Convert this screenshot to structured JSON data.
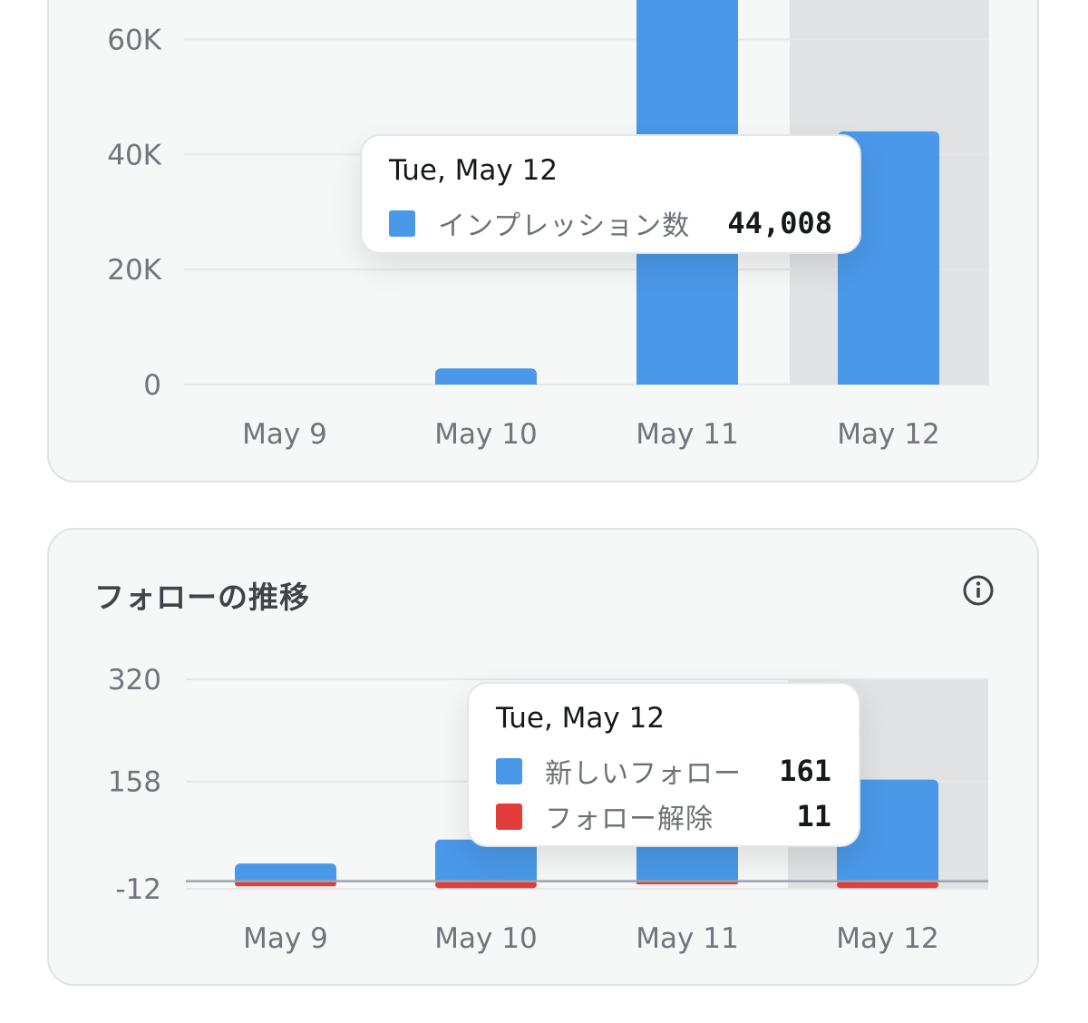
{
  "colors": {
    "blue": "#4a98e8",
    "red": "#e23d3a",
    "grid": "#e3e7ea",
    "axis_text": "#6f757b",
    "highlight": "#e1e2e3"
  },
  "impressions_card": {
    "tooltip": {
      "title": "Tue, May 12",
      "label": "インプレッション数",
      "value": "44,008"
    }
  },
  "follows_card": {
    "title": "フォローの推移",
    "info_icon": "info-icon",
    "tooltip": {
      "title": "Tue, May 12",
      "rows": [
        {
          "label": "新しいフォロー",
          "value": "161"
        },
        {
          "label": "フォロー解除",
          "value": "11"
        }
      ]
    }
  },
  "chart_data": [
    {
      "type": "bar",
      "categories": [
        "May 9",
        "May 10",
        "May 11",
        "May 12"
      ],
      "series": [
        {
          "name": "インプレッション数",
          "values": [
            0,
            2800,
            75000,
            44008
          ]
        }
      ],
      "yticks": [
        0,
        20000,
        40000,
        60000
      ],
      "ytick_labels": [
        "0",
        "20K",
        "40K",
        "60K"
      ],
      "ylim": [
        0,
        70000
      ],
      "highlighted_category": "May 12",
      "grid": true
    },
    {
      "type": "bar",
      "stacked": true,
      "categories": [
        "May 9",
        "May 10",
        "May 11",
        "May 12"
      ],
      "series": [
        {
          "name": "新しいフォロー",
          "values": [
            28,
            66,
            215,
            161
          ]
        },
        {
          "name": "フォロー解除",
          "values": [
            -8,
            -11,
            -5,
            -11
          ]
        }
      ],
      "yticks": [
        -12,
        158,
        320
      ],
      "ytick_labels": [
        "-12",
        "158",
        "320"
      ],
      "ylim": [
        -12,
        320
      ],
      "highlighted_category": "May 12",
      "grid": true
    }
  ]
}
